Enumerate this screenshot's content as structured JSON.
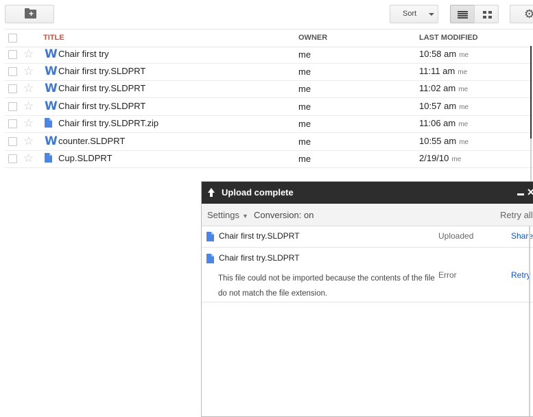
{
  "toolbar": {
    "new_folder_icon": "folder-plus-icon",
    "sort_label": "Sort",
    "list_view_icon": "list-view-icon",
    "grid_view_icon": "grid-view-icon",
    "settings_icon": "gear-icon"
  },
  "table": {
    "headers": {
      "title": "TITLE",
      "owner": "OWNER",
      "last_modified": "LAST MODIFIED"
    },
    "rows": [
      {
        "icon": "word-doc-icon",
        "name": "Chair first try",
        "owner": "me",
        "time": "10:58 am",
        "by": "me"
      },
      {
        "icon": "word-doc-icon",
        "name": "Chair first try.SLDPRT",
        "owner": "me",
        "time": "11:11 am",
        "by": "me"
      },
      {
        "icon": "word-doc-icon",
        "name": "Chair first try.SLDPRT",
        "owner": "me",
        "time": "11:02 am",
        "by": "me"
      },
      {
        "icon": "word-doc-icon",
        "name": "Chair first try.SLDPRT",
        "owner": "me",
        "time": "10:57 am",
        "by": "me"
      },
      {
        "icon": "file-icon",
        "name": "Chair first try.SLDPRT.zip",
        "owner": "me",
        "time": "11:06 am",
        "by": "me"
      },
      {
        "icon": "word-doc-icon",
        "name": "counter.SLDPRT",
        "owner": "me",
        "time": "10:55 am",
        "by": "me"
      },
      {
        "icon": "file-icon",
        "name": "Cup.SLDPRT",
        "owner": "me",
        "time": "2/19/10",
        "by": "me"
      }
    ]
  },
  "upload_panel": {
    "title": "Upload complete",
    "settings_label": "Settings",
    "conversion_label": "Conversion: on",
    "retry_all_label": "Retry all",
    "items": [
      {
        "name": "Chair first try.SLDPRT",
        "status": "Uploaded",
        "action": "Share",
        "message": ""
      },
      {
        "name": "Chair first try.SLDPRT",
        "status": "Error",
        "action": "Retry",
        "message": "This file could not be imported because the contents of the file do not match the file extension."
      }
    ]
  },
  "colors": {
    "accent_red": "#dd4b39",
    "doc_blue": "#4a86e8",
    "link_blue": "#1155cc",
    "panel_header": "#2d2d2d"
  }
}
